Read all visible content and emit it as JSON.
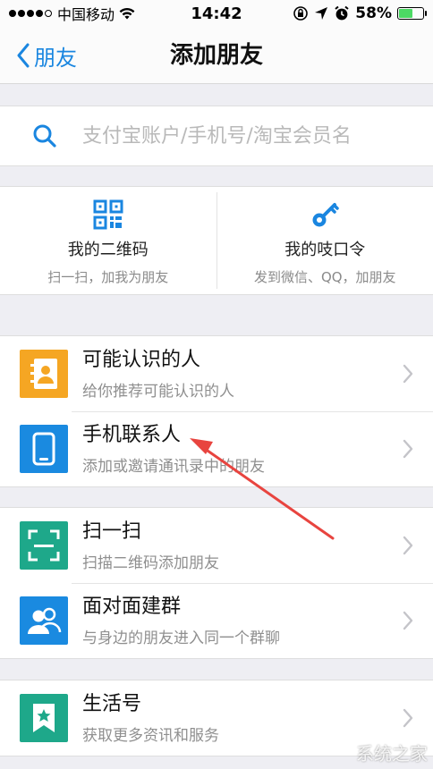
{
  "status_bar": {
    "carrier": "中国移动",
    "time": "14:42",
    "battery_text": "58%",
    "battery_level": 0.58
  },
  "nav": {
    "back_label": "朋友",
    "title": "添加朋友"
  },
  "search": {
    "placeholder": "支付宝账户/手机号/淘宝会员名",
    "value": ""
  },
  "quick_actions": [
    {
      "icon": "qr-code-icon",
      "title": "我的二维码",
      "subtitle": "扫一扫，加我为朋友"
    },
    {
      "icon": "key-icon",
      "title": "我的吱口令",
      "subtitle": "发到微信、QQ，加朋友"
    }
  ],
  "groups": [
    {
      "items": [
        {
          "icon": "contact-book-icon",
          "color": "#f5a623",
          "title": "可能认识的人",
          "subtitle": "给你推荐可能认识的人"
        },
        {
          "icon": "phone-icon",
          "color": "#1a8ae0",
          "title": "手机联系人",
          "subtitle": "添加或邀请通讯录中的朋友"
        }
      ]
    },
    {
      "items": [
        {
          "icon": "scan-icon",
          "color": "#1ea88a",
          "title": "扫一扫",
          "subtitle": "扫描二维码添加朋友"
        },
        {
          "icon": "group-icon",
          "color": "#1a8ae0",
          "title": "面对面建群",
          "subtitle": "与身边的朋友进入同一个群聊"
        }
      ]
    },
    {
      "items": [
        {
          "icon": "bookmark-star-icon",
          "color": "#1ea88a",
          "title": "生活号",
          "subtitle": "获取更多资讯和服务"
        }
      ]
    }
  ],
  "colors": {
    "accent": "#1a86e0",
    "annotation_arrow": "#e8443f"
  },
  "watermark": "系统之家"
}
